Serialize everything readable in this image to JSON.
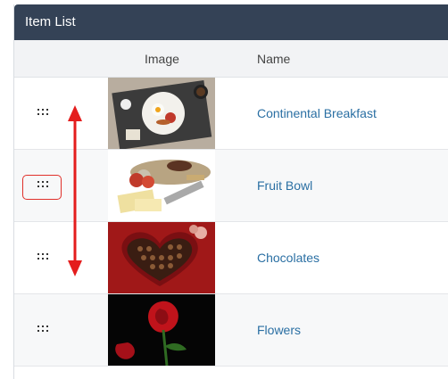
{
  "panel": {
    "title": "Item List"
  },
  "columns": {
    "image": "Image",
    "name": "Name"
  },
  "rows": [
    {
      "name": "Continental Breakfast",
      "image_icon": "breakfast-image"
    },
    {
      "name": "Fruit Bowl",
      "image_icon": "cheese-platter-image"
    },
    {
      "name": "Chocolates",
      "image_icon": "chocolates-image"
    },
    {
      "name": "Flowers",
      "image_icon": "roses-image"
    }
  ],
  "annotation": {
    "color": "#e0302a"
  },
  "colors": {
    "header": "#344256",
    "link": "#2a6fa3"
  }
}
